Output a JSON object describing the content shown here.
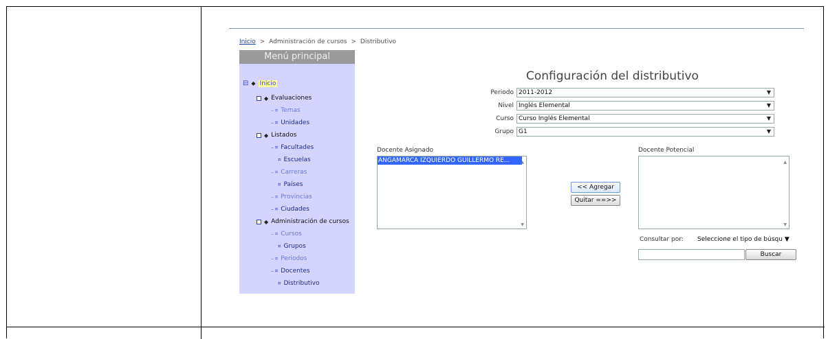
{
  "breadcrumb": {
    "home": "Inicio",
    "sep1": ">",
    "section": "Administración de cursos",
    "sep2": ">",
    "current": "Distributivo"
  },
  "menu": {
    "title": "Menú principal",
    "items": [
      {
        "label": "Inicio"
      },
      {
        "label": "Evaluaciones"
      },
      {
        "label": "Temas"
      },
      {
        "label": "Unidades"
      },
      {
        "label": "Listados"
      },
      {
        "label": "Facultades"
      },
      {
        "label": "Escuelas"
      },
      {
        "label": "Carreras"
      },
      {
        "label": "Países"
      },
      {
        "label": "Provincias"
      },
      {
        "label": "Ciudades"
      },
      {
        "label": "Administración de cursos"
      },
      {
        "label": "Cursos"
      },
      {
        "label": "Grupos"
      },
      {
        "label": "Periodos"
      },
      {
        "label": "Docentes"
      },
      {
        "label": "Distributivo"
      }
    ]
  },
  "form": {
    "title": "Configuración del distributivo",
    "periodo_label": "Periodo",
    "periodo_value": "2011-2012",
    "nivel_label": "Nivel",
    "nivel_value": "Inglés Elemental",
    "curso_label": "Curso",
    "curso_value": "Curso Inglés Elemental",
    "grupo_label": "Grupo",
    "grupo_value": "G1"
  },
  "assigned": {
    "label": "Docente Asignado",
    "items": [
      "ANGAMARCA IZQUIERDO GUILLERMO RE..."
    ]
  },
  "potential": {
    "label": "Docente Potencial",
    "items": []
  },
  "buttons": {
    "agregar": "<<  Agregar",
    "quitar": "Quitar ==>>",
    "buscar": "Buscar"
  },
  "search": {
    "consult_label": "Consultar por:",
    "type_value": "Seleccione el tipo de búsqu",
    "query_value": ""
  },
  "colors": {
    "menu_bg": "#d4d4ff",
    "menu_header": "#9a9a9a",
    "selection": "#3366ff"
  }
}
